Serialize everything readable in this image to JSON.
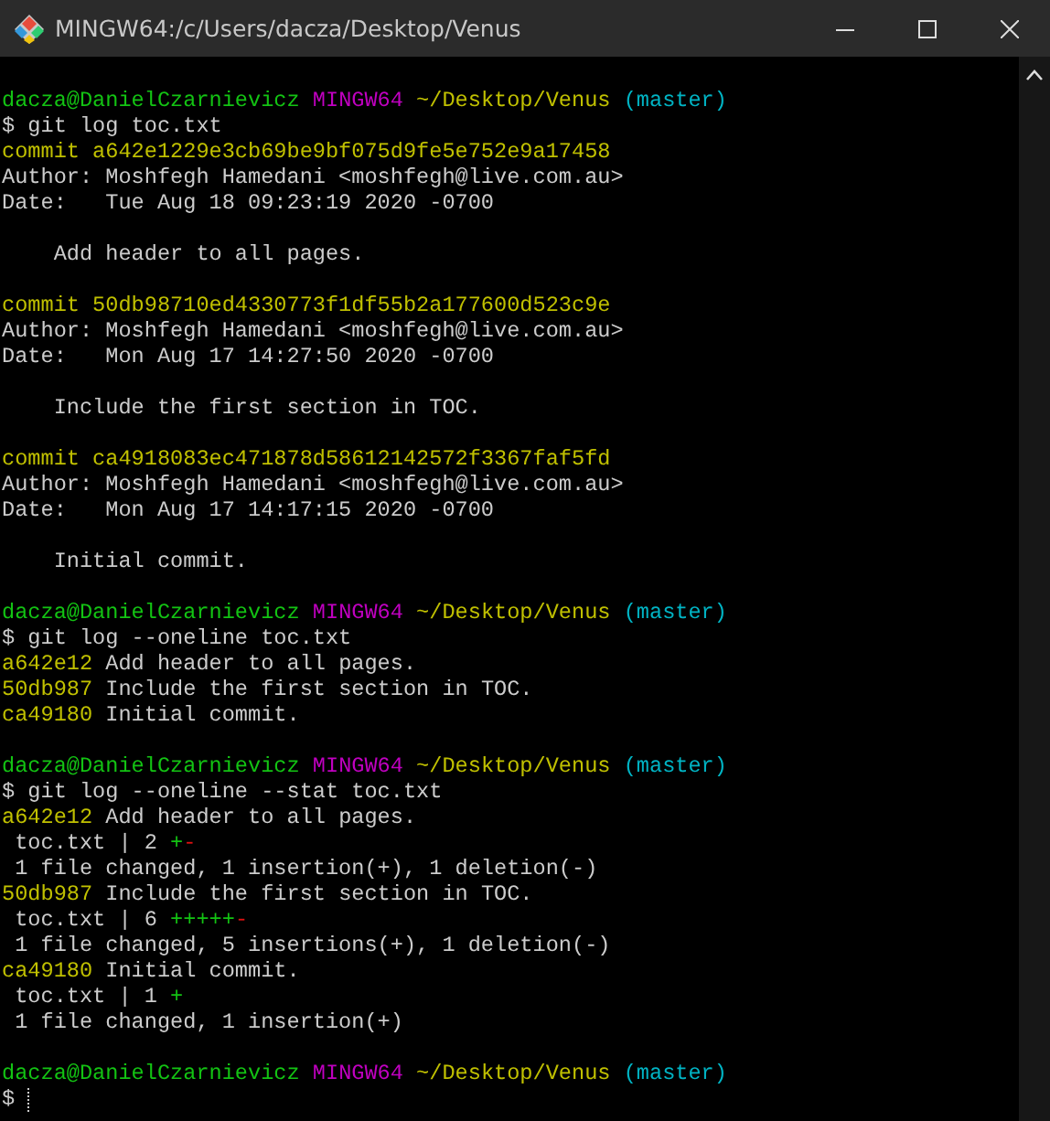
{
  "window": {
    "title": "MINGW64:/c/Users/dacza/Desktop/Venus"
  },
  "lines": [
    {
      "kind": "blank"
    },
    {
      "kind": "text",
      "segments": [
        {
          "kind": "user",
          "text": "dacza@DanielCzarnievicz"
        },
        {
          "kind": "shell",
          "text": "MINGW64"
        },
        {
          "kind": "path",
          "text": "~/Desktop/Venus"
        },
        {
          "kind": "branch",
          "text": "(master)"
        }
      ]
    },
    {
      "kind": "text",
      "segments": [
        {
          "kind": "plain",
          "text": "$ git log toc.txt"
        }
      ]
    },
    {
      "kind": "text",
      "segments": [
        {
          "kind": "hash",
          "text": "commit a642e1229e3cb69be9bf075d9fe5e752e9a17458"
        }
      ]
    },
    {
      "kind": "text",
      "segments": [
        {
          "kind": "plain",
          "text": "Author: Moshfegh Hamedani <moshfegh@live.com.au>"
        }
      ]
    },
    {
      "kind": "text",
      "segments": [
        {
          "kind": "plain",
          "text": "Date:   Tue Aug 18 09:23:19 2020 -0700"
        }
      ]
    },
    {
      "kind": "blank"
    },
    {
      "kind": "text",
      "segments": [
        {
          "kind": "plain",
          "text": "    Add header to all pages."
        }
      ]
    },
    {
      "kind": "blank"
    },
    {
      "kind": "text",
      "segments": [
        {
          "kind": "hash",
          "text": "commit 50db98710ed4330773f1df55b2a177600d523c9e"
        }
      ]
    },
    {
      "kind": "text",
      "segments": [
        {
          "kind": "plain",
          "text": "Author: Moshfegh Hamedani <moshfegh@live.com.au>"
        }
      ]
    },
    {
      "kind": "text",
      "segments": [
        {
          "kind": "plain",
          "text": "Date:   Mon Aug 17 14:27:50 2020 -0700"
        }
      ]
    },
    {
      "kind": "blank"
    },
    {
      "kind": "text",
      "segments": [
        {
          "kind": "plain",
          "text": "    Include the first section in TOC."
        }
      ]
    },
    {
      "kind": "blank"
    },
    {
      "kind": "text",
      "segments": [
        {
          "kind": "hash",
          "text": "commit ca4918083ec471878d58612142572f3367faf5fd"
        }
      ]
    },
    {
      "kind": "text",
      "segments": [
        {
          "kind": "plain",
          "text": "Author: Moshfegh Hamedani <moshfegh@live.com.au>"
        }
      ]
    },
    {
      "kind": "text",
      "segments": [
        {
          "kind": "plain",
          "text": "Date:   Mon Aug 17 14:17:15 2020 -0700"
        }
      ]
    },
    {
      "kind": "blank"
    },
    {
      "kind": "text",
      "segments": [
        {
          "kind": "plain",
          "text": "    Initial commit."
        }
      ]
    },
    {
      "kind": "blank"
    },
    {
      "kind": "text",
      "segments": [
        {
          "kind": "user",
          "text": "dacza@DanielCzarnievicz"
        },
        {
          "kind": "shell",
          "text": "MINGW64"
        },
        {
          "kind": "path",
          "text": "~/Desktop/Venus"
        },
        {
          "kind": "branch",
          "text": "(master)"
        }
      ]
    },
    {
      "kind": "text",
      "segments": [
        {
          "kind": "plain",
          "text": "$ git log --oneline toc.txt"
        }
      ]
    },
    {
      "kind": "text",
      "segments": [
        {
          "kind": "hash",
          "text": "a642e12"
        },
        {
          "kind": "plain",
          "text": " Add header to all pages."
        }
      ]
    },
    {
      "kind": "text",
      "segments": [
        {
          "kind": "hash",
          "text": "50db987"
        },
        {
          "kind": "plain",
          "text": " Include the first section in TOC."
        }
      ]
    },
    {
      "kind": "text",
      "segments": [
        {
          "kind": "hash",
          "text": "ca49180"
        },
        {
          "kind": "plain",
          "text": " Initial commit."
        }
      ]
    },
    {
      "kind": "blank"
    },
    {
      "kind": "text",
      "segments": [
        {
          "kind": "user",
          "text": "dacza@DanielCzarnievicz"
        },
        {
          "kind": "shell",
          "text": "MINGW64"
        },
        {
          "kind": "path",
          "text": "~/Desktop/Venus"
        },
        {
          "kind": "branch",
          "text": "(master)"
        }
      ]
    },
    {
      "kind": "text",
      "segments": [
        {
          "kind": "plain",
          "text": "$ git log --oneline --stat toc.txt"
        }
      ]
    },
    {
      "kind": "text",
      "segments": [
        {
          "kind": "hash",
          "text": "a642e12"
        },
        {
          "kind": "plain",
          "text": " Add header to all pages."
        }
      ]
    },
    {
      "kind": "text",
      "segments": [
        {
          "kind": "plain",
          "text": " toc.txt | 2 "
        },
        {
          "kind": "add",
          "text": "+"
        },
        {
          "kind": "del",
          "text": "-"
        }
      ]
    },
    {
      "kind": "text",
      "segments": [
        {
          "kind": "plain",
          "text": " 1 file changed, 1 insertion(+), 1 deletion(-)"
        }
      ]
    },
    {
      "kind": "text",
      "segments": [
        {
          "kind": "hash",
          "text": "50db987"
        },
        {
          "kind": "plain",
          "text": " Include the first section in TOC."
        }
      ]
    },
    {
      "kind": "text",
      "segments": [
        {
          "kind": "plain",
          "text": " toc.txt | 6 "
        },
        {
          "kind": "add",
          "text": "+++++"
        },
        {
          "kind": "del",
          "text": "-"
        }
      ]
    },
    {
      "kind": "text",
      "segments": [
        {
          "kind": "plain",
          "text": " 1 file changed, 5 insertions(+), 1 deletion(-)"
        }
      ]
    },
    {
      "kind": "text",
      "segments": [
        {
          "kind": "hash",
          "text": "ca49180"
        },
        {
          "kind": "plain",
          "text": " Initial commit."
        }
      ]
    },
    {
      "kind": "text",
      "segments": [
        {
          "kind": "plain",
          "text": " toc.txt | 1 "
        },
        {
          "kind": "add",
          "text": "+"
        }
      ]
    },
    {
      "kind": "text",
      "segments": [
        {
          "kind": "plain",
          "text": " 1 file changed, 1 insertion(+)"
        }
      ]
    },
    {
      "kind": "blank"
    },
    {
      "kind": "text",
      "segments": [
        {
          "kind": "user",
          "text": "dacza@DanielCzarnievicz"
        },
        {
          "kind": "shell",
          "text": "MINGW64"
        },
        {
          "kind": "path",
          "text": "~/Desktop/Venus"
        },
        {
          "kind": "branch",
          "text": "(master)"
        }
      ]
    },
    {
      "kind": "text",
      "segments": [
        {
          "kind": "plain",
          "text": "$ "
        }
      ],
      "cursor": true
    }
  ]
}
